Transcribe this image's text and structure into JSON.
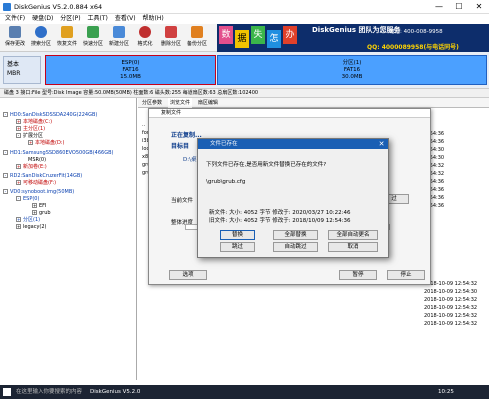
{
  "window": {
    "title": "DiskGenius V5.2.0.884 x64",
    "min": "—",
    "max": "☐",
    "close": "✕"
  },
  "menu": [
    "文件(F)",
    "硬盘(D)",
    "分区(P)",
    "工具(T)",
    "查看(V)",
    "帮助(H)"
  ],
  "toolbar": [
    "保存更改",
    "搜索分区",
    "恢复文件",
    "快速分区",
    "新建分区",
    "格式化",
    "删除分区",
    "备份分区"
  ],
  "banner": {
    "chars": [
      "数",
      "据",
      "失",
      "怎",
      "办"
    ],
    "brand": "DiskGenius 团队为您服务",
    "qq": "QQ: 4000089958(与电话同号)",
    "phone": "电话: 400-008-9958"
  },
  "disk": {
    "basic": "基本",
    "mbr": "MBR",
    "p1_name": "ESP(0)",
    "p1_fs": "FAT16",
    "p1_size": "15.0MB",
    "p2_name": "分区(1)",
    "p2_fs": "FAT16",
    "p2_size": "30.0MB"
  },
  "diskinfo": "磁盘 3 接口:File  型号:Disk Image  容量:50.0MB(50MB)  柱面数:6  磁头数:255  每道扇区数:63  总扇区数:102400",
  "tree": [
    {
      "label": "HD0:SanDiskSDSSDA240G(224GB)",
      "cls": "blue"
    },
    {
      "label": "本地磁盘(C:)",
      "cls": "red"
    },
    {
      "label": "主分区(1)",
      "cls": "red"
    },
    {
      "label": "扩展分区",
      "cls": ""
    },
    {
      "label": "本地磁盘(D:)",
      "cls": "red"
    },
    {
      "label": "HD1:SamsungSSD860EVO500GB(466GB)",
      "cls": "blue"
    },
    {
      "label": "MSR(0)",
      "cls": ""
    },
    {
      "label": "新加卷(E:)",
      "cls": "red"
    },
    {
      "label": "RD2:SanDiskCruzerFit(14GB)",
      "cls": "blue"
    },
    {
      "label": "可移动磁盘(F:)",
      "cls": "red"
    },
    {
      "label": "VD0:synoboot.img(50MB)",
      "cls": "blue"
    },
    {
      "label": "ESP(0)",
      "cls": "blue"
    },
    {
      "label": "EFI",
      "cls": ""
    },
    {
      "label": "grub",
      "cls": ""
    },
    {
      "label": "分区(1)",
      "cls": "blue"
    },
    {
      "label": "legacy(2)",
      "cls": ""
    }
  ],
  "tabs": [
    "分区参数",
    "浏览文件",
    "扇区编辑"
  ],
  "filelist": {
    "header": "名称",
    "names": [
      "..",
      "fonts",
      "i386-pc",
      "locale",
      "x86_64-efi",
      "grub",
      "grub.cfg"
    ],
    "dates": [
      "2018-10-09 12:54:36",
      "2018-10-09 12:54:36",
      "2018-10-09 12:54:30",
      "2018-10-09 12:54:30",
      "2018-10-09 12:54:32",
      "2018-10-09 12:54:32",
      "2018-10-09 12:54:36",
      "2018-10-09 12:54:36",
      "2018-10-09 12:54:36",
      "2018-10-09 12:54:36",
      "2018-10-09 12:54:32",
      "2018-10-09 12:54:30",
      "2018-10-09 12:54:32",
      "2018-10-09 12:54:32",
      "2018-10-09 12:54:32",
      "2018-10-09 12:54:32"
    ]
  },
  "copy": {
    "title": "复制文件",
    "copying": "正在复制...",
    "target": "目标目",
    "path": "D:\\桌面",
    "current": "当前文件",
    "overall": "整体进度",
    "skip_btn": "过",
    "options": "选项",
    "pause": "暂停",
    "stop": "停止"
  },
  "exists": {
    "title": "文件已存在",
    "question": "下列文件已存在,是否用新文件替换已存在的文件?",
    "file": "\\grub\\grub.cfg",
    "new_line": "新文件: 大小: 4052 字节  修改于: 2020/03/27 10:22:46",
    "old_line": "旧文件: 大小: 4052 字节  修改于: 2018/10/09 12:54:36",
    "btns": [
      "替换",
      "全部替换",
      "全部自动更名",
      "跳过",
      "自动跳过",
      "取消"
    ]
  },
  "taskbar": {
    "search": "在这里输入你要搜索的内容",
    "app": "DiskGenius V5.2.0",
    "time": "10:25"
  },
  "colors": {
    "partition": "#4ba0ff",
    "titleblue": "#1a5fb4",
    "banner": "#0d2d6b"
  }
}
